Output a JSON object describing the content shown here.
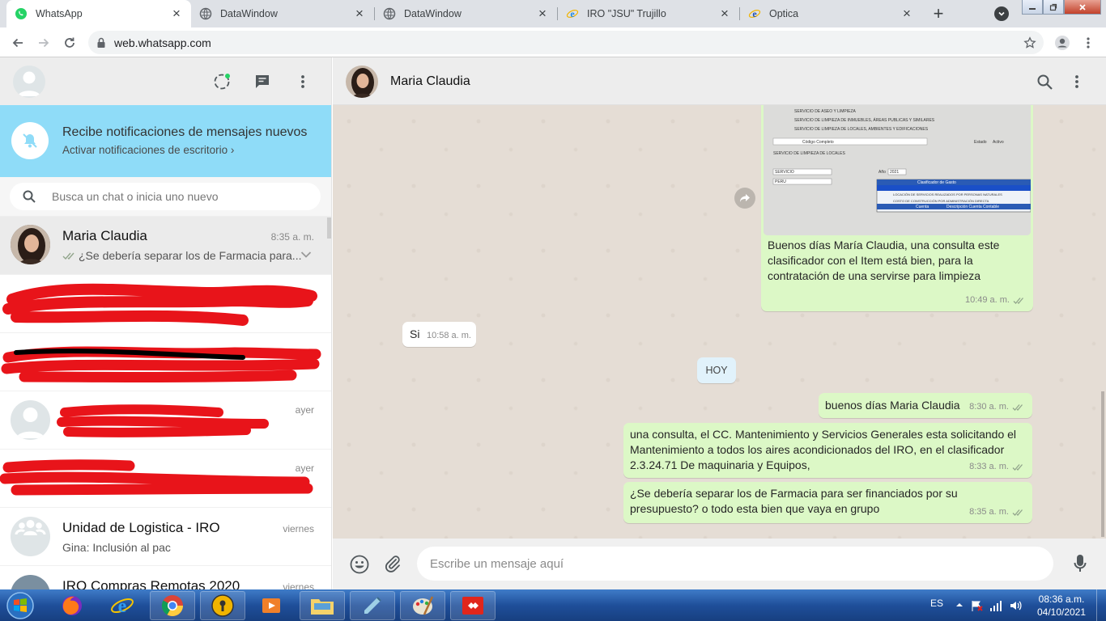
{
  "browser": {
    "tabs": [
      {
        "label": "WhatsApp",
        "icon": "whatsapp-icon",
        "active": true
      },
      {
        "label": "DataWindow",
        "icon": "globe-icon"
      },
      {
        "label": "DataWindow",
        "icon": "globe-icon"
      },
      {
        "label": "IRO \"JSU\" Trujillo",
        "icon": "ie-icon"
      },
      {
        "label": "Optica",
        "icon": "ie-icon"
      }
    ],
    "close_glyph": "×",
    "new_tab_glyph": "+",
    "url": "web.whatsapp.com"
  },
  "sidebar": {
    "notification": {
      "title": "Recibe notificaciones de mensajes nuevos",
      "action": "Activar notificaciones de escritorio ›"
    },
    "search_placeholder": "Busca un chat o inicia uno nuevo",
    "chats": [
      {
        "name": "Maria Claudia",
        "time": "8:35 a. m.",
        "preview": "¿Se debería separar los de Farmacia para..."
      },
      {
        "name": "",
        "time": "",
        "preview": "",
        "redacted": true
      },
      {
        "name": "",
        "time": "",
        "preview": "",
        "redacted": true
      },
      {
        "name": "",
        "time": "ayer",
        "preview": "",
        "redacted": true
      },
      {
        "name": "",
        "time": "ayer",
        "preview": "",
        "redacted": true
      },
      {
        "name": "Unidad de Logistica - IRO",
        "time": "viernes",
        "preview": "Gina: Inclusión al pac"
      },
      {
        "name": "IRO Compras Remotas 2020",
        "time": "viernes",
        "preview": ""
      }
    ]
  },
  "conversation": {
    "contact_name": "Maria Claudia",
    "messages": [
      {
        "type": "out",
        "image": true,
        "text": "Buenos días María Claudia, una consulta este clasificador con el Item está bien, para la contratación de una servirse para limpieza",
        "time": "10:49 a. m."
      },
      {
        "type": "in",
        "text": "Si",
        "time": "10:58 a. m."
      },
      {
        "type": "date",
        "text": "HOY"
      },
      {
        "type": "out",
        "text": "buenos días Maria Claudia",
        "time": "8:30 a. m."
      },
      {
        "type": "out",
        "text": "una consulta, el CC. Mantenimiento y Servicios Generales esta solicitando el Mantenimiento a todos los aires acondicionados del IRO, en el clasificador 2.3.24.71 De maquinaria y Equipos,",
        "time": "8:33 a. m."
      },
      {
        "type": "out",
        "text": "¿Se debería separar los de Farmacia para ser financiados por su presupuesto? o todo esta bien que vaya en grupo",
        "time": "8:35 a. m."
      }
    ],
    "image_caption_lines": [
      "SERVICIO DE ASEO Y LIMPIEZA",
      "SERVICIO DE LIMPIEZA DE INMUEBLES, ÁREAS PUBLICAS Y SIMILARES",
      "SERVICIO DE LIMPIEZA DE LOCALES, AMBIENTES Y EDIFICACIONES",
      "Código Completo",
      "Estado",
      "Activo",
      "SERVICIO DE LIMPIEZA DE LOCALES",
      "SERVICIO",
      "PERU",
      "Año",
      "2021",
      "Clasificador de Gasto",
      "LOCACIÓN DE SERVICIOS REALIZADOS POR PERSONAS NATURALES",
      "COSTO DE CONSTRUCCIÓN POR ADMINISTRACIÓN DIRECTA",
      "Cuenta",
      "Descripción Cuenta Contable"
    ],
    "composer_placeholder": "Escribe un mensaje aquí"
  },
  "taskbar": {
    "language": "ES",
    "time": "08:36 a.m.",
    "date": "04/10/2021"
  },
  "colors": {
    "outgoing_bubble": "#dcf8c6",
    "notification_banner": "#8fdcf8",
    "chat_background": "#e5ddd5",
    "whatsapp_green": "#25d366"
  }
}
